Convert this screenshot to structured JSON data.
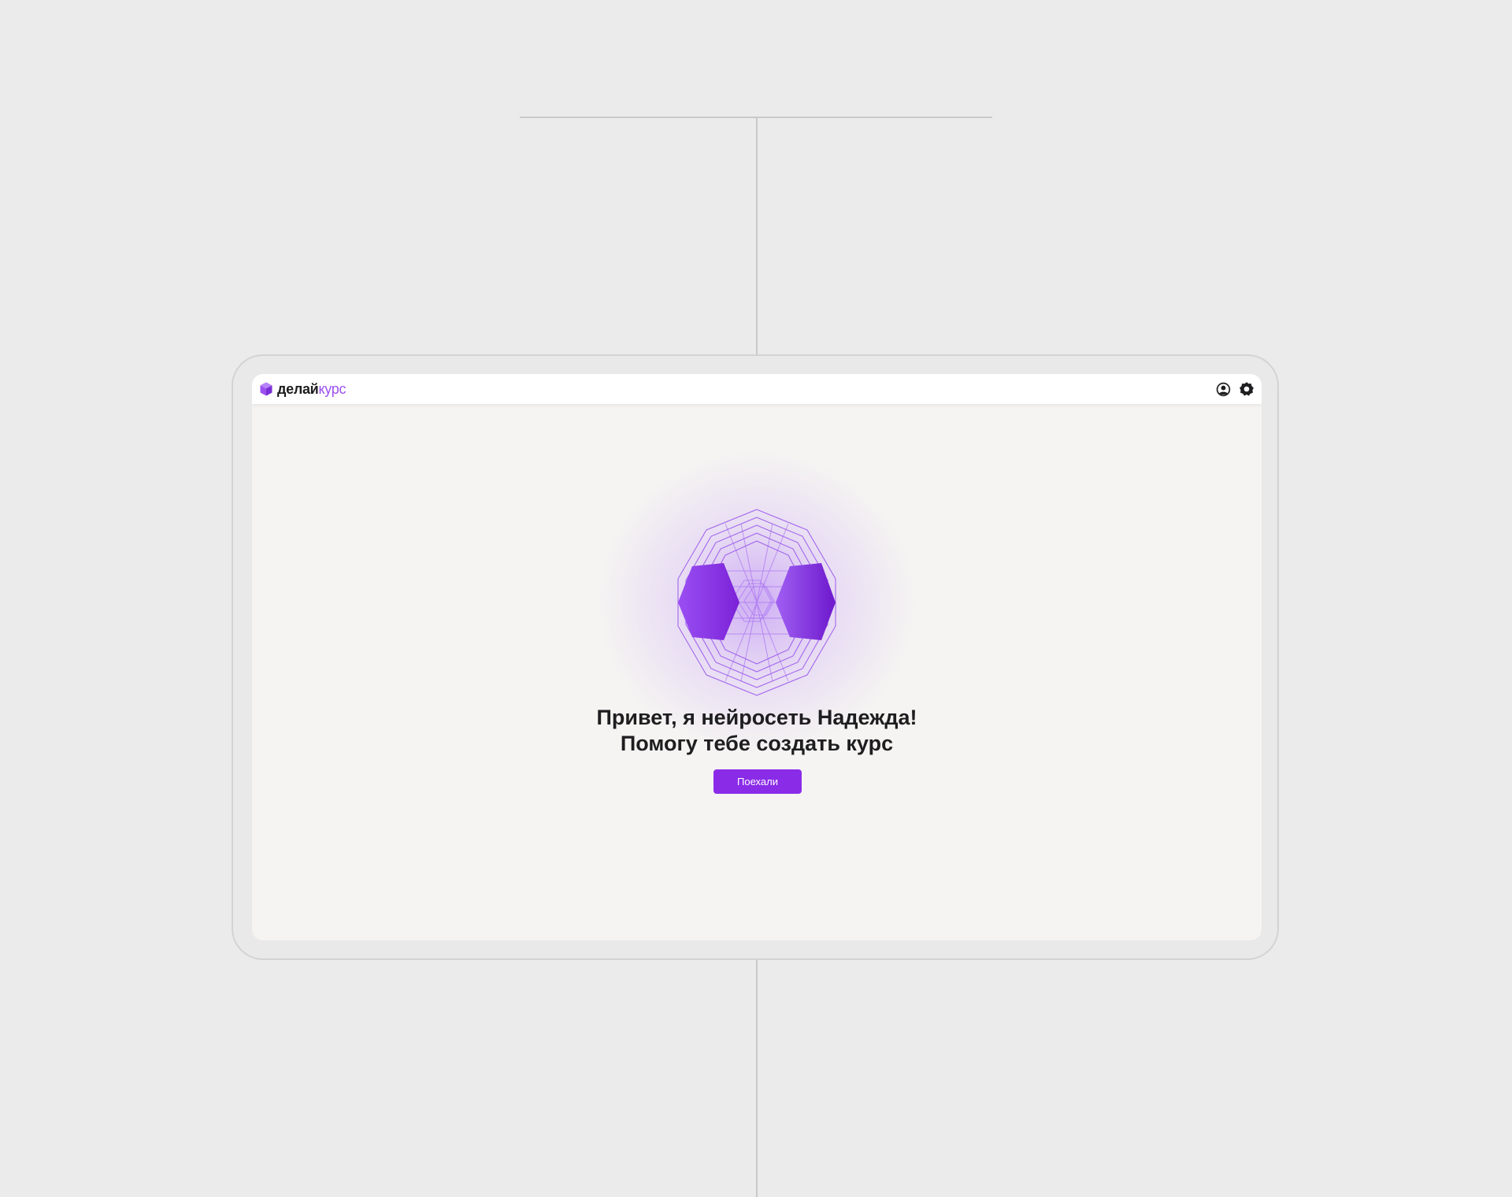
{
  "brand": {
    "name_part1": "делай",
    "name_part2": "курс",
    "accent_color": "#8a2be8",
    "logo_icon": "cube-icon"
  },
  "header": {
    "icons": [
      "user-account-icon",
      "gear-icon"
    ]
  },
  "hero": {
    "illustration": "hexagon-orb-icon",
    "line1": "Привет, я нейросеть Надежда!",
    "line2": "Помогу тебе создать курс"
  },
  "actions": {
    "start_label": "Поехали"
  }
}
